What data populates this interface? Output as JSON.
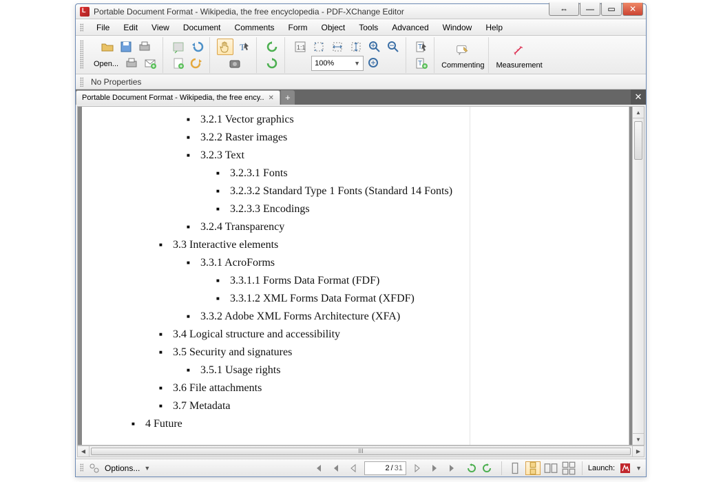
{
  "titlebar": {
    "title": "Portable Document Format - Wikipedia, the free encyclopedia - PDF-XChange Editor"
  },
  "menu": {
    "file": "File",
    "edit": "Edit",
    "view": "View",
    "document": "Document",
    "comments": "Comments",
    "form": "Form",
    "object": "Object",
    "tools": "Tools",
    "advanced": "Advanced",
    "window": "Window",
    "help": "Help"
  },
  "toolbar": {
    "open": "Open...",
    "commenting": "Commenting",
    "measurement": "Measurement",
    "zoom": "100%"
  },
  "propbar": {
    "text": "No Properties"
  },
  "tab": {
    "label": "Portable Document Format - Wikipedia, the free ency.."
  },
  "toc": [
    {
      "level": 2,
      "text": "3.2.1 Vector graphics"
    },
    {
      "level": 2,
      "text": "3.2.2 Raster images"
    },
    {
      "level": 2,
      "text": "3.2.3 Text"
    },
    {
      "level": 3,
      "text": "3.2.3.1 Fonts"
    },
    {
      "level": 3,
      "text": "3.2.3.2 Standard Type 1 Fonts (Standard 14 Fonts)"
    },
    {
      "level": 3,
      "text": "3.2.3.3 Encodings"
    },
    {
      "level": 2,
      "text": "3.2.4 Transparency"
    },
    {
      "level": 1,
      "text": "3.3 Interactive elements"
    },
    {
      "level": 2,
      "text": "3.3.1 AcroForms"
    },
    {
      "level": 3,
      "text": "3.3.1.1 Forms Data Format (FDF)"
    },
    {
      "level": 3,
      "text": "3.3.1.2 XML Forms Data Format (XFDF)"
    },
    {
      "level": 2,
      "text": "3.3.2 Adobe XML Forms Architecture (XFA)"
    },
    {
      "level": 1,
      "text": "3.4 Logical structure and accessibility"
    },
    {
      "level": 1,
      "text": "3.5 Security and signatures"
    },
    {
      "level": 2,
      "text": "3.5.1 Usage rights"
    },
    {
      "level": 1,
      "text": "3.6 File attachments"
    },
    {
      "level": 1,
      "text": "3.7 Metadata"
    },
    {
      "level": 0,
      "text": "4 Future"
    }
  ],
  "status": {
    "options": "Options...",
    "page": "2",
    "total": "31",
    "launch": "Launch:"
  }
}
